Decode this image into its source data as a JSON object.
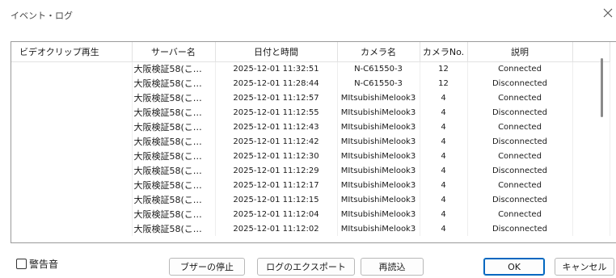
{
  "window": {
    "title": "イベント・ログ"
  },
  "table": {
    "columns": [
      "ビデオクリップ再生",
      "サーバー名",
      "日付と時間",
      "カメラ名",
      "カメラNo.",
      "説明",
      ""
    ],
    "rows": [
      {
        "server": "大阪検証58(こ…",
        "datetime": "2025-12-01 11:32:51",
        "camera": "N-C61550-3",
        "camera_no": "12",
        "description": "Connected"
      },
      {
        "server": "大阪検証58(こ…",
        "datetime": "2025-12-01 11:28:44",
        "camera": "N-C61550-3",
        "camera_no": "12",
        "description": "Disconnected"
      },
      {
        "server": "大阪検証58(こ…",
        "datetime": "2025-12-01 11:12:57",
        "camera": "MItsubishiMelook3",
        "camera_no": "4",
        "description": "Connected"
      },
      {
        "server": "大阪検証58(こ…",
        "datetime": "2025-12-01 11:12:55",
        "camera": "MItsubishiMelook3",
        "camera_no": "4",
        "description": "Disconnected"
      },
      {
        "server": "大阪検証58(こ…",
        "datetime": "2025-12-01 11:12:43",
        "camera": "MItsubishiMelook3",
        "camera_no": "4",
        "description": "Connected"
      },
      {
        "server": "大阪検証58(こ…",
        "datetime": "2025-12-01 11:12:42",
        "camera": "MItsubishiMelook3",
        "camera_no": "4",
        "description": "Disconnected"
      },
      {
        "server": "大阪検証58(こ…",
        "datetime": "2025-12-01 11:12:30",
        "camera": "MItsubishiMelook3",
        "camera_no": "4",
        "description": "Connected"
      },
      {
        "server": "大阪検証58(こ…",
        "datetime": "2025-12-01 11:12:29",
        "camera": "MItsubishiMelook3",
        "camera_no": "4",
        "description": "Disconnected"
      },
      {
        "server": "大阪検証58(こ…",
        "datetime": "2025-12-01 11:12:17",
        "camera": "MItsubishiMelook3",
        "camera_no": "4",
        "description": "Connected"
      },
      {
        "server": "大阪検証58(こ…",
        "datetime": "2025-12-01 11:12:15",
        "camera": "MItsubishiMelook3",
        "camera_no": "4",
        "description": "Disconnected"
      },
      {
        "server": "大阪検証58(こ…",
        "datetime": "2025-12-01 11:12:04",
        "camera": "MItsubishiMelook3",
        "camera_no": "4",
        "description": "Connected"
      },
      {
        "server": "大阪検証58(こ…",
        "datetime": "2025-12-01 11:12:02",
        "camera": "MItsubishiMelook3",
        "camera_no": "4",
        "description": "Disconnected"
      }
    ]
  },
  "footer": {
    "warning_sound_label": "警告音",
    "buttons": {
      "stop_buzzer": "ブザーの停止",
      "export_log": "ログのエクスポート",
      "reload": "再読込",
      "ok": "OK",
      "cancel": "キャンセル"
    }
  },
  "icons": {
    "close": "close-icon",
    "checkbox": "checkbox-icon"
  },
  "colors": {
    "accent": "#0067c0",
    "scroll_thumb": "#8a8a8a"
  }
}
